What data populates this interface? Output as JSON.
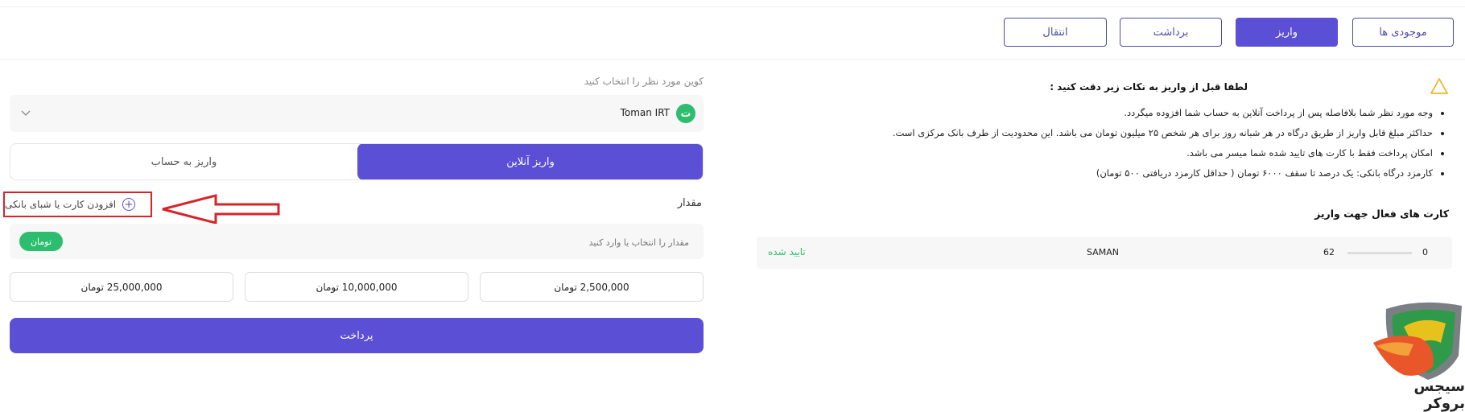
{
  "tabs": [
    "موجودی ها",
    "واریز",
    "برداشت",
    "انتقال"
  ],
  "coin": {
    "label": "کوین مورد نظر را انتخاب کنید",
    "badge": "ت",
    "selected": "Toman IRT"
  },
  "deposit_modes": {
    "online": "واریز آنلاین",
    "to_account": "واریز به حساب"
  },
  "amount": {
    "label": "مقدار",
    "add_card": "افزودن کارت یا شبای بانکی",
    "placeholder": "مقدار را انتخاب یا وارد کنید",
    "unit": "تومان"
  },
  "presets": [
    "2,500,000 تومان",
    "10,000,000 تومان",
    "25,000,000 تومان"
  ],
  "pay_button": "پرداخت",
  "notice": {
    "title": "لطفا قبل از واریز به نکات زیر دقت کنید :",
    "items": [
      "وجه مورد نظر شما بلافاصله پس از پرداخت آنلاین به حساب شما افزوده میگردد.",
      "حداکثر مبلغ قابل واریز از طریق درگاه در هر شبانه روز برای هر شخص ۲۵ میلیون تومان می باشد. این محدودیت از طرف بانک مرکزی است.",
      "امکان پرداخت فقط با کارت های تایید شده شما میسر می باشد.",
      "کارمزد درگاه بانکی: یک درصد تا سقف ۶۰۰۰ تومان ( حداقل کارمزد دریافتی ۵۰۰ تومان)"
    ]
  },
  "cards": {
    "title": "کارت های فعال جهت واریز",
    "rows": [
      {
        "num_end": "0",
        "num_start": "62",
        "bank": "SAMAN",
        "status": "تایید شده"
      }
    ]
  },
  "watermark": "سیجس بروکر",
  "colors": {
    "primary": "#5b4fd6",
    "success": "#2dbd6e",
    "highlight": "#d6242a"
  }
}
